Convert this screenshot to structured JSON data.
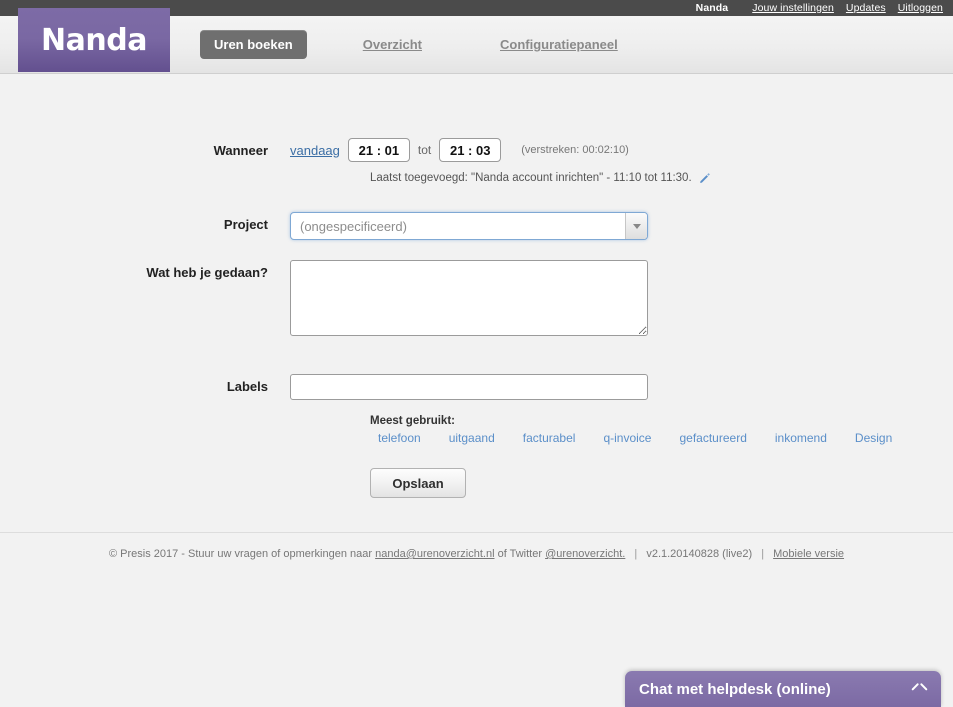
{
  "topbar": {
    "user": "Nanda",
    "links": [
      {
        "label": "Jouw instellingen"
      },
      {
        "label": "Updates"
      },
      {
        "label": "Uitloggen"
      }
    ]
  },
  "brand": {
    "logo_text": "Nanda",
    "logo_color": "#7a68a3"
  },
  "nav": {
    "items": [
      {
        "label": "Uren boeken",
        "active": true
      },
      {
        "label": "Overzicht",
        "active": false
      },
      {
        "label": "Configuratiepaneel",
        "active": false
      }
    ]
  },
  "form": {
    "wanneer": {
      "label": "Wanneer",
      "today_link": "vandaag",
      "start_time": "21 : 01",
      "separator": "tot",
      "end_time": "21 : 03",
      "elapsed": "(verstreken: 00:02:10)",
      "last_added": "Laatst toegevoegd: \"Nanda account inrichten\" - 11:10 tot 11:30.",
      "edit_icon": "pencil-icon"
    },
    "project": {
      "label": "Project",
      "selected": "(ongespecificeerd)",
      "options": [
        "(ongespecificeerd)"
      ]
    },
    "description": {
      "label": "Wat heb je gedaan?",
      "value": "",
      "placeholder": ""
    },
    "labels": {
      "label": "Labels",
      "value": "",
      "placeholder": "",
      "most_used_heading": "Meest gebruikt:",
      "tags": [
        {
          "label": "telefoon"
        },
        {
          "label": "uitgaand"
        },
        {
          "label": "facturabel"
        },
        {
          "label": "q-invoice"
        },
        {
          "label": "gefactureerd"
        },
        {
          "label": "inkomend"
        },
        {
          "label": "Design"
        }
      ]
    },
    "save_label": "Opslaan"
  },
  "footer": {
    "copyright": "© Presis 2017 - Stuur uw vragen of opmerkingen naar",
    "email": "nanda@urenoverzicht.nl",
    "twitter_prefix": "of Twitter",
    "twitter_handle": "@urenoverzicht.",
    "version": "v2.1.20140828 (live2)",
    "mobile_link": "Mobiele versie",
    "separator": "|"
  },
  "chat": {
    "title": "Chat met helpdesk (online)",
    "toggle_icon": "chevron-up-icon",
    "accent_color": "#7c6aa4"
  }
}
